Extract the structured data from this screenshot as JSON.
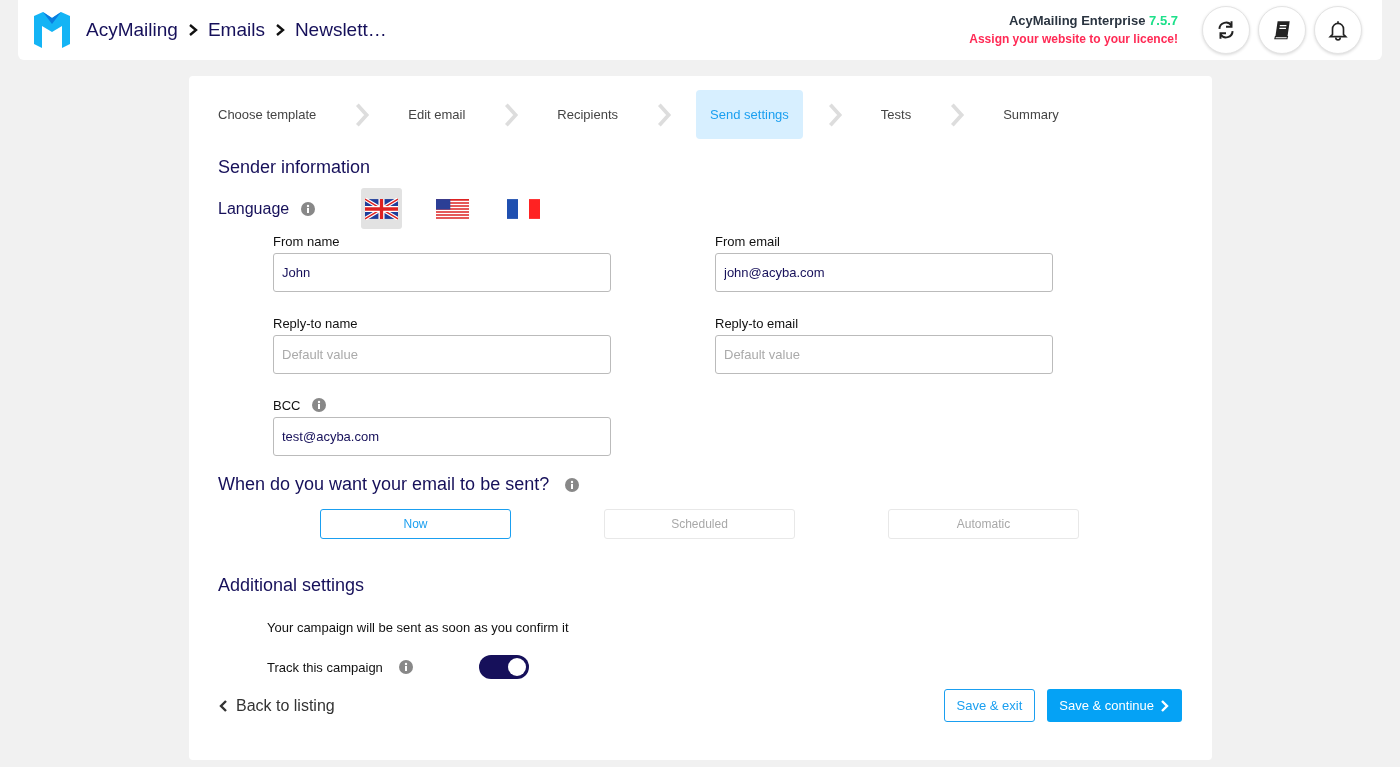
{
  "header": {
    "breadcrumb": [
      "AcyMailing",
      "Emails",
      "Newslett…"
    ],
    "edition": "AcyMailing Enterprise",
    "version": "7.5.7",
    "licence_warning": "Assign your website to your licence!"
  },
  "steps": [
    {
      "label": "Choose template",
      "selected": false
    },
    {
      "label": "Edit email",
      "selected": false
    },
    {
      "label": "Recipients",
      "selected": false
    },
    {
      "label": "Send settings",
      "selected": true
    },
    {
      "label": "Tests",
      "selected": false
    },
    {
      "label": "Summary",
      "selected": false
    }
  ],
  "sender": {
    "title": "Sender information",
    "language_label": "Language",
    "languages": [
      {
        "kind": "uk",
        "selected": true
      },
      {
        "kind": "us",
        "selected": false
      },
      {
        "kind": "fr",
        "selected": false
      }
    ],
    "fields": [
      {
        "label": "From name",
        "value": "John",
        "info": false
      },
      {
        "label": "From email",
        "value": "john@acyba.com",
        "info": false
      },
      {
        "label": "Reply-to name",
        "placeholder": "Default value",
        "info": false
      },
      {
        "label": "Reply-to email",
        "placeholder": "Default value",
        "info": false
      },
      {
        "label": "BCC",
        "value": "test@acyba.com",
        "info": true
      }
    ]
  },
  "sending": {
    "title": "When do you want your email to be sent?",
    "options": [
      {
        "label": "Now",
        "selected": true
      },
      {
        "label": "Scheduled",
        "selected": false
      },
      {
        "label": "Automatic",
        "selected": false
      }
    ]
  },
  "additional": {
    "title": "Additional settings",
    "note": "Your campaign will be sent as soon as you confirm it",
    "track_label": "Track this campaign",
    "track_on": true
  },
  "footer": {
    "back": "Back to listing",
    "save_exit": "Save & exit",
    "save_continue": "Save & continue"
  }
}
